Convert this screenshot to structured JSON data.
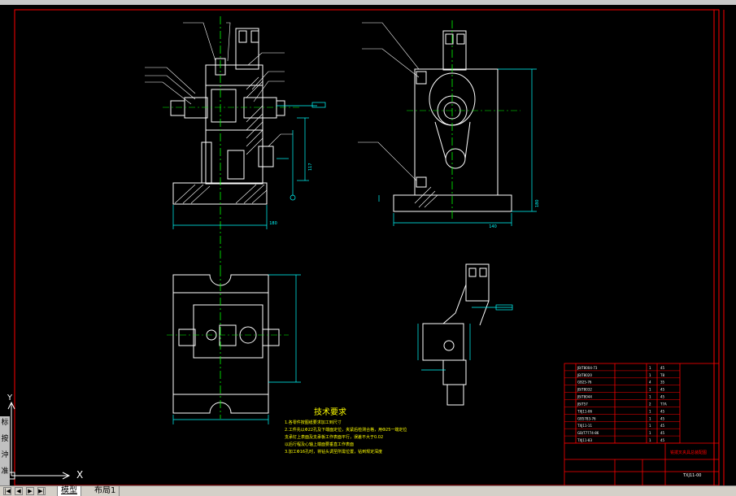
{
  "title_block": {
    "rows": [
      [
        "JB/T8004-73",
        "",
        "1",
        "45"
      ],
      [
        "JB/T8020",
        "",
        "1",
        "T8"
      ],
      [
        "GB25-76",
        "",
        "4",
        "35"
      ],
      [
        "JB/T8032",
        "",
        "1",
        "45"
      ],
      [
        "JB/T8044",
        "",
        "1",
        "45"
      ],
      [
        "JB/T57",
        "",
        "2",
        "T7A"
      ],
      [
        "TXJ11-06",
        "",
        "1",
        "45"
      ],
      [
        "GB5783-76",
        "",
        "1",
        "45"
      ],
      [
        "TXJ11-11",
        "",
        "1",
        "45"
      ],
      [
        "GB/T7774-86",
        "",
        "1",
        "45"
      ],
      [
        "TXJ11-83",
        "",
        "1",
        "45"
      ]
    ],
    "drawing_title": "铣拨叉夹具总装配图",
    "drawing_code": "TXJ11-00"
  },
  "tech_requirements": {
    "heading": "技术要求",
    "lines": [
      "1.各零件按图纸要求加工到尺寸",
      "2.工件先以Φ22孔及下端面定位，夹紧后检测合格，用Φ25一端定位",
      "支承钉上表面及支承板工作表面平行，误差不大于0.02",
      "以后行程及心轴上端面要垂直工作表面",
      "3.加工Φ16孔时，将钻头调至所需位置，钻到规定深度"
    ]
  },
  "dimensions": {
    "d1": "180",
    "d2": "117",
    "d3": "140",
    "d4": "180",
    "d5": "65"
  },
  "ucs": {
    "x_label": "X",
    "y_label": "Y"
  },
  "tabs": [
    {
      "label": "模型"
    },
    {
      "label": "布局1"
    }
  ],
  "nav": {
    "first": "|◀",
    "prev": "◀",
    "next": "▶",
    "last": "▶|"
  },
  "left_tools": [
    "标",
    "按",
    "沖",
    "准"
  ],
  "colors": {
    "background": "#000000",
    "outline": "#ffffff",
    "dimension": "#00ffff",
    "centerline": "#00ff00",
    "leader": "#ffffff",
    "hatch": "#ffffff",
    "border": "#ff0000",
    "text": "#ffff00"
  }
}
